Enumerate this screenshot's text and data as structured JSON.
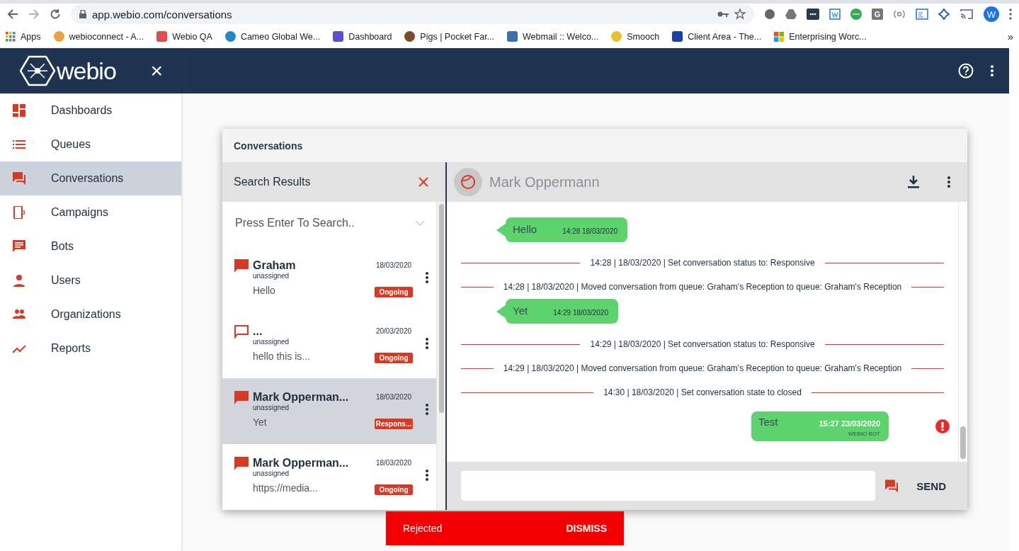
{
  "browser": {
    "url": "app.webio.com/conversations",
    "extension_badge": "G",
    "profile_initial": "W",
    "bookmarks": [
      {
        "label": "Apps"
      },
      {
        "label": "webioconnect - A..."
      },
      {
        "label": "Webio QA"
      },
      {
        "label": "Cameo Global We..."
      },
      {
        "label": "Dashboard"
      },
      {
        "label": "Pigs | Pocket Far..."
      },
      {
        "label": "Webmail :: Welco..."
      },
      {
        "label": "Smooch"
      },
      {
        "label": "Client Area - The..."
      },
      {
        "label": "Enterprising Worc..."
      }
    ],
    "overflow": "»"
  },
  "sidebar": {
    "logo_text": "webio",
    "close": "×",
    "items": [
      {
        "label": "Dashboards",
        "selected": false
      },
      {
        "label": "Queues",
        "selected": false
      },
      {
        "label": "Conversations",
        "selected": true
      },
      {
        "label": "Campaigns",
        "selected": false
      },
      {
        "label": "Bots",
        "selected": false
      },
      {
        "label": "Users",
        "selected": false
      },
      {
        "label": "Organizations",
        "selected": false
      },
      {
        "label": "Reports",
        "selected": false
      }
    ]
  },
  "card": {
    "title": "Conversations",
    "list": {
      "title": "Search Results",
      "search_placeholder": "Press Enter To Search..",
      "items": [
        {
          "name": "Graham",
          "assignee": "unassigned",
          "preview": "Hello",
          "date": "18/03/2020",
          "status": "Ongoing",
          "unread": true,
          "selected": false
        },
        {
          "name": "...",
          "assignee": "unassigned",
          "preview": "hello this is...",
          "date": "20/03/2020",
          "status": "Ongoing",
          "unread": false,
          "selected": false
        },
        {
          "name": "Mark Opperman...",
          "assignee": "unassigned",
          "preview": "Yet",
          "date": "18/03/2020",
          "status": "Respons...",
          "unread": true,
          "selected": true
        },
        {
          "name": "Mark Opperman...",
          "assignee": "unassigned",
          "preview": "https://media...",
          "date": "18/03/2020",
          "status": "Ongoing",
          "unread": true,
          "selected": false
        }
      ]
    },
    "chat": {
      "contact": "Mark Oppermann",
      "messages": [
        {
          "kind": "incoming",
          "text": "Hello",
          "time": "14:28 18/03/2020"
        },
        {
          "kind": "event",
          "text": "14:28 | 18/03/2020 | Set conversation status to: Responsive"
        },
        {
          "kind": "event",
          "text": "14:28 | 18/03/2020 | Moved conversation from queue: Graham's Reception to queue: Graham's Reception"
        },
        {
          "kind": "incoming",
          "text": "Yet",
          "time": "14:29 18/03/2020"
        },
        {
          "kind": "event",
          "text": "14:29 | 18/03/2020 | Set conversation status to: Responsive"
        },
        {
          "kind": "event",
          "text": "14:29 | 18/03/2020 | Moved conversation from queue: Graham's Reception to queue: Graham's Reception"
        },
        {
          "kind": "event",
          "text": "14:30 | 18/03/2020 | Set conversation state to closed"
        },
        {
          "kind": "outgoing",
          "text": "Test",
          "time": "15:27 23/03/2020",
          "sender": "WEBIO BOT",
          "failed": true
        }
      ],
      "send": "SEND"
    }
  },
  "snackbar": {
    "message": "Rejected",
    "action": "DISMISS"
  }
}
